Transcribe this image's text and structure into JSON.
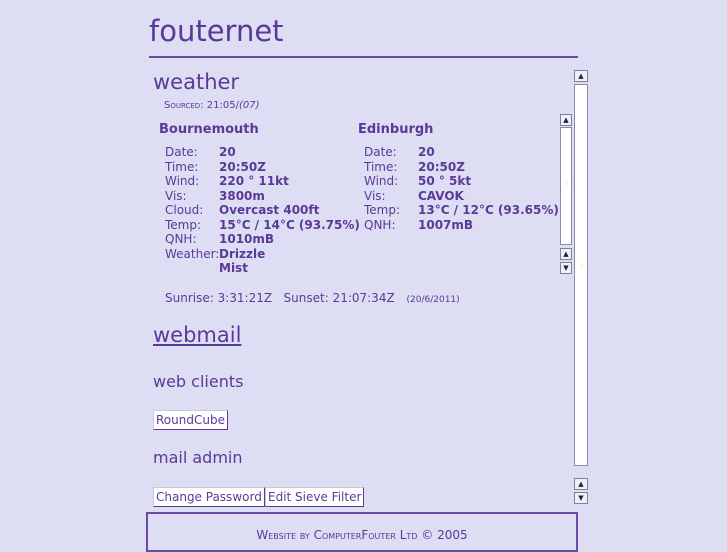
{
  "site": {
    "title": "fouternet"
  },
  "weather": {
    "heading": "weather",
    "sourced_label": "Sourced: 21:05/",
    "sourced_value": "(07)",
    "cities": [
      {
        "name": "Bournemouth",
        "rows": [
          {
            "label": "Date:",
            "value": "20"
          },
          {
            "label": "Time:",
            "value": "20:50Z"
          },
          {
            "label": "Wind:",
            "value": "220 °  11kt"
          },
          {
            "label": "Vis:",
            "value": "3800m"
          },
          {
            "label": "Cloud:",
            "value": "Overcast 400ft"
          },
          {
            "label": "Temp:",
            "value": "15°C / 14°C  (93.75%)"
          },
          {
            "label": "QNH:",
            "value": "1010mB"
          },
          {
            "label": "Weather:",
            "value": "Drizzle"
          },
          {
            "label": "",
            "value": "Mist"
          }
        ]
      },
      {
        "name": "Edinburgh",
        "rows": [
          {
            "label": "Date:",
            "value": "20"
          },
          {
            "label": "Time:",
            "value": "20:50Z"
          },
          {
            "label": "Wind:",
            "value": "50 °  5kt"
          },
          {
            "label": "Vis:",
            "value": "CAVOK"
          },
          {
            "label": "Temp:",
            "value": "13°C / 12°C  (93.65%)"
          },
          {
            "label": "QNH:",
            "value": "1007mB"
          }
        ]
      }
    ],
    "sun": {
      "sunrise": "Sunrise: 3:31:21Z",
      "sunset": "Sunset: 21:07:34Z",
      "date": "(20/6/2011)"
    }
  },
  "webmail": {
    "heading": "webmail",
    "clients_heading": "web clients",
    "roundcube_label": "RoundCube",
    "admin_heading": "mail admin",
    "change_password_label": "Change Password",
    "edit_sieve_label": "Edit Sieve Filter"
  },
  "footer": {
    "text": "Website by ComputerFouter Ltd  © 2005"
  },
  "colors": {
    "background": "#ddddf4",
    "accent": "#5a3a96",
    "rule": "#6c4aa8"
  },
  "icons": {
    "up": "arrow-up-icon",
    "down": "arrow-down-icon"
  }
}
